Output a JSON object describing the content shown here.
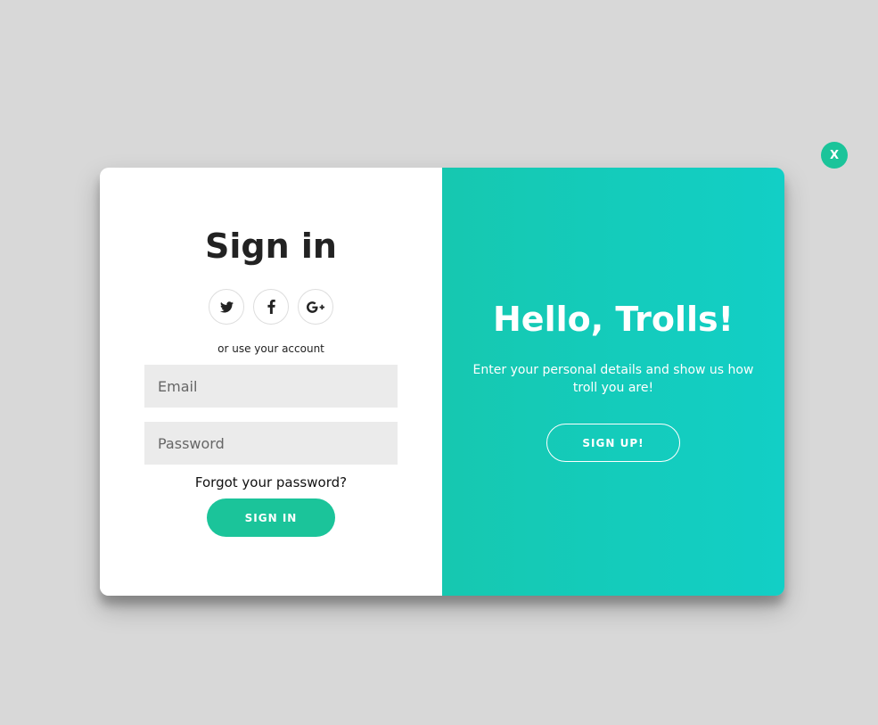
{
  "close_button": {
    "label": "X"
  },
  "signin": {
    "title": "Sign in",
    "social": [
      {
        "icon": "twitter-icon",
        "glyph": "twitter"
      },
      {
        "icon": "facebook-icon",
        "glyph": "f"
      },
      {
        "icon": "google-plus-icon",
        "glyph": "G+"
      }
    ],
    "or_text": "or use your account",
    "email_placeholder": "Email",
    "password_placeholder": "Password",
    "forgot_label": "Forgot your password?",
    "submit_label": "SIGN IN"
  },
  "signup_panel": {
    "title": "Hello, Trolls!",
    "description": "Enter your personal details and show us how troll you are!",
    "button_label": "SIGN UP!"
  },
  "colors": {
    "accent": "#1bc49a",
    "panel_gradient_start": "#16c8b0",
    "panel_gradient_end": "#12cfc6",
    "page_background": "#d8d8d8"
  }
}
